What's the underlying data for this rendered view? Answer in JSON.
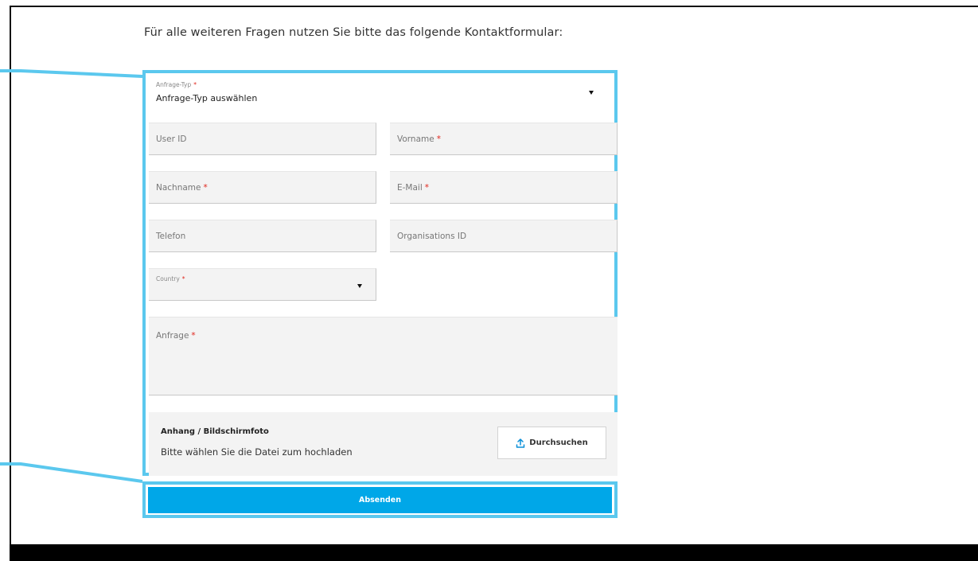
{
  "intro_text": "Für alle weiteren Fragen nutzen Sie bitte das folgende Kontaktformular:",
  "required_marker": "*",
  "form": {
    "request_type": {
      "label": "Anfrage-Typ",
      "value": "Anfrage-Typ auswählen"
    },
    "user_id": {
      "placeholder": "User ID"
    },
    "first_name": {
      "placeholder": "Vorname"
    },
    "last_name": {
      "placeholder": "Nachname"
    },
    "email": {
      "placeholder": "E-Mail"
    },
    "phone": {
      "placeholder": "Telefon"
    },
    "org_id": {
      "placeholder": "Organisations ID"
    },
    "country": {
      "label": "Country",
      "value": ""
    },
    "request": {
      "placeholder": "Anfrage"
    },
    "attachment": {
      "title": "Anhang / Bildschirmfoto",
      "hint": "Bitte wählen Sie die Datei zum hochladen",
      "browse_label": "Durchsuchen"
    },
    "submit_label": "Absenden"
  },
  "colors": {
    "highlight": "#5bc8ee",
    "primary_button": "#00a7e8",
    "required": "#e0261d",
    "field_bg": "#f3f3f3"
  },
  "icons": {
    "dropdown": "caret-down-icon",
    "upload": "upload-icon"
  }
}
